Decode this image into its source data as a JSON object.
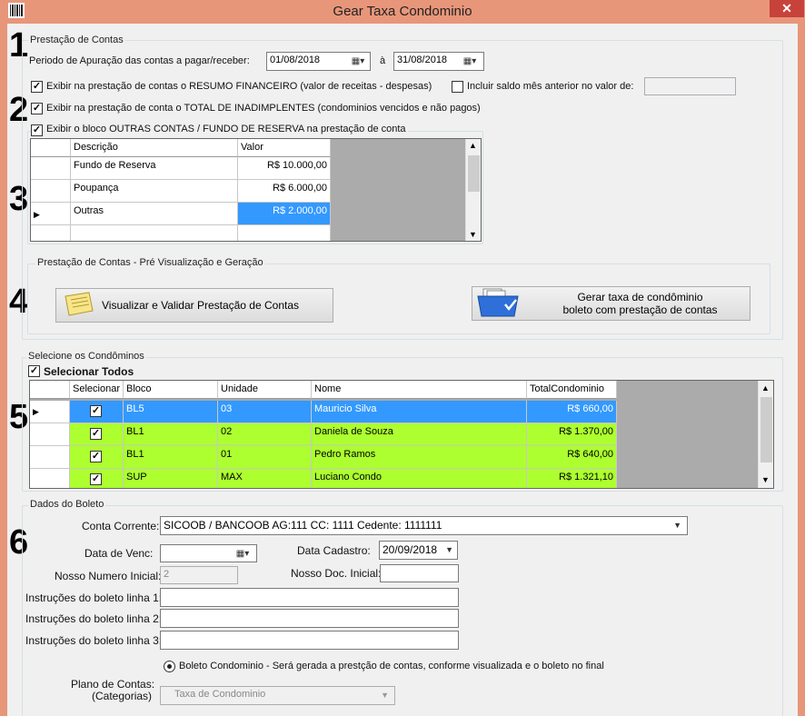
{
  "window": {
    "title": "Gear Taxa Condominio",
    "close": "✕"
  },
  "section_numbers": [
    "1",
    "2",
    "3",
    "4",
    "5",
    "6"
  ],
  "prestacao": {
    "group_label": "Prestação de Contas",
    "periodo_label": "Periodo de Apuração das contas a pagar/receber:",
    "date_from": "01/08/2018",
    "a_label": "à",
    "date_to": "31/08/2018",
    "resumo_label": "Exibir na prestação de contas o RESUMO FINANCEIRO (valor de receitas - despesas)",
    "resumo_checked": true,
    "incluir_label": "Incluir saldo mês anterior no valor de:",
    "incluir_checked": false,
    "incluir_value": "",
    "inadimplentes_label": "Exibir na prestação de conta o TOTAL DE INADIMPLENTES  (condominios vencidos e não pagos)",
    "inadimplentes_checked": true,
    "outras_label": "Exibir o bloco OUTRAS CONTAS / FUNDO DE RESERVA na prestação de conta",
    "outras_checked": true
  },
  "contas_grid": {
    "headers": [
      "Descrição",
      "Valor"
    ],
    "rows": [
      {
        "descricao": "Fundo de Reserva",
        "valor": "R$ 10.000,00"
      },
      {
        "descricao": "Poupança",
        "valor": "R$ 6.000,00"
      },
      {
        "descricao": "Outras",
        "valor": "R$ 2.000,00"
      },
      {
        "descricao": "",
        "valor": ""
      }
    ]
  },
  "visualizacao": {
    "group_label": "Prestação de Contas - Pré Visualização e Geração",
    "visualizar_btn": "Visualizar e Validar Prestação de Contas",
    "gerar_btn_line1": "Gerar taxa de condôminio",
    "gerar_btn_line2": "boleto com prestação de contas"
  },
  "condominos": {
    "group_label": "Selecione os Condôminos",
    "selecionar_todos": "Selecionar Todos",
    "headers": [
      "Selecionar",
      "Bloco",
      "Unidade",
      "Nome",
      "TotalCondominio"
    ],
    "rows": [
      {
        "selecionado": true,
        "bloco": "BL5",
        "unidade": "03",
        "nome": "Mauricio Silva",
        "total": "R$ 660,00"
      },
      {
        "selecionado": true,
        "bloco": "BL1",
        "unidade": "02",
        "nome": "Daniela de Souza",
        "total": "R$ 1.370,00"
      },
      {
        "selecionado": true,
        "bloco": "BL1",
        "unidade": "01",
        "nome": "Pedro Ramos",
        "total": "R$ 640,00"
      },
      {
        "selecionado": true,
        "bloco": "SUP",
        "unidade": "MAX",
        "nome": "Luciano Condo",
        "total": "R$ 1.321,10"
      }
    ],
    "colors": {
      "selected_row": "#3399FF",
      "row": "#ADFF2F"
    }
  },
  "boleto": {
    "group_label": "Dados do Boleto",
    "conta_label": "Conta Corrente:",
    "conta_value": "SICOOB / BANCOOB AG:111 CC: 1111 Cedente: 1111111",
    "venc_label": "Data de Venc:",
    "venc_value": "",
    "cadastro_label": "Data Cadastro:",
    "cadastro_value": "20/09/2018",
    "nosso_numero_label": "Nosso Numero Inicial:",
    "nosso_numero_value": "2",
    "nosso_doc_label": "Nosso Doc. Inicial:",
    "nosso_doc_value": "",
    "instr1_label": "Instruções do boleto linha 1:",
    "instr2_label": "Instruções do boleto linha 2:",
    "instr3_label": "Instruções do boleto linha 3:",
    "instr1_value": "",
    "instr2_value": "",
    "instr3_value": "",
    "radio_label": "Boleto Condominio -  Será gerada a prestção de contas, conforme visualizada e o boleto no final",
    "plano_label1": "Plano de Contas:",
    "plano_label2": "(Categorias)",
    "plano_value": "Taxa de Condominio"
  }
}
